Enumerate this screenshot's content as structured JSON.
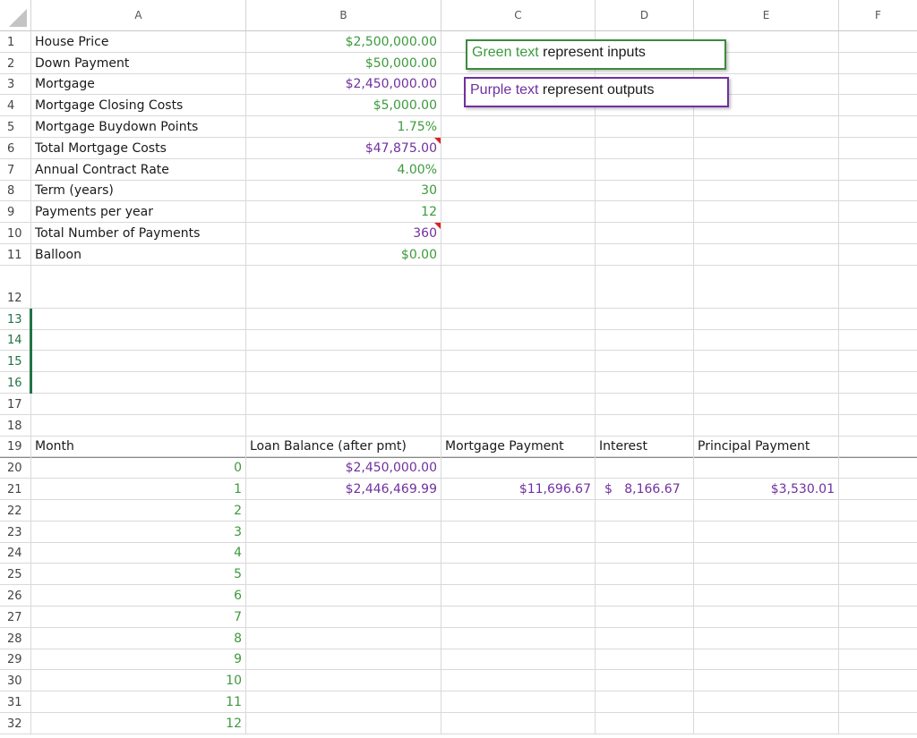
{
  "columns": [
    "A",
    "B",
    "C",
    "D",
    "E",
    "F"
  ],
  "rows": [
    {
      "n": "1",
      "a": "House Price",
      "b": "$2,500,000.00",
      "bc": "green"
    },
    {
      "n": "2",
      "a": "Down Payment",
      "b": "$50,000.00",
      "bc": "green"
    },
    {
      "n": "3",
      "a": "Mortgage",
      "b": "$2,450,000.00",
      "bc": "purple"
    },
    {
      "n": "4",
      "a": "Mortgage Closing Costs",
      "b": "$5,000.00",
      "bc": "green"
    },
    {
      "n": "5",
      "a": "Mortgage Buydown Points",
      "b": "1.75%",
      "bc": "green"
    },
    {
      "n": "6",
      "a": "Total Mortgage Costs",
      "b": "$47,875.00",
      "bc": "purple",
      "comment": true
    },
    {
      "n": "7",
      "a": "Annual Contract Rate",
      "b": "4.00%",
      "bc": "green"
    },
    {
      "n": "8",
      "a": "Term (years)",
      "b": "30",
      "bc": "green"
    },
    {
      "n": "9",
      "a": "Payments per year",
      "b": "12",
      "bc": "green"
    },
    {
      "n": "10",
      "a": "Total Number of Payments",
      "b": "360",
      "bc": "purple",
      "comment": true
    },
    {
      "n": "11",
      "a": "Balloon",
      "b": "$0.00",
      "bc": "green"
    }
  ],
  "empty_rows": [
    "12",
    "13",
    "14",
    "15",
    "16",
    "17",
    "18"
  ],
  "table_header": {
    "n": "19",
    "month": "Month",
    "balance": "Loan Balance (after pmt)",
    "payment": "Mortgage Payment",
    "interest": "Interest",
    "principal": "Principal Payment"
  },
  "table_rows": [
    {
      "n": "20",
      "month": "0",
      "balance": "$2,450,000.00",
      "payment": "",
      "interest": "",
      "principal": ""
    },
    {
      "n": "21",
      "month": "1",
      "balance": "$2,446,469.99",
      "payment": "$11,696.67",
      "interest": "$   8,166.67",
      "principal": "$3,530.01"
    },
    {
      "n": "22",
      "month": "2",
      "balance": "",
      "payment": "",
      "interest": "",
      "principal": ""
    },
    {
      "n": "23",
      "month": "3",
      "balance": "",
      "payment": "",
      "interest": "",
      "principal": ""
    },
    {
      "n": "24",
      "month": "4",
      "balance": "",
      "payment": "",
      "interest": "",
      "principal": ""
    },
    {
      "n": "25",
      "month": "5",
      "balance": "",
      "payment": "",
      "interest": "",
      "principal": ""
    },
    {
      "n": "26",
      "month": "6",
      "balance": "",
      "payment": "",
      "interest": "",
      "principal": ""
    },
    {
      "n": "27",
      "month": "7",
      "balance": "",
      "payment": "",
      "interest": "",
      "principal": ""
    },
    {
      "n": "28",
      "month": "8",
      "balance": "",
      "payment": "",
      "interest": "",
      "principal": ""
    },
    {
      "n": "29",
      "month": "9",
      "balance": "",
      "payment": "",
      "interest": "",
      "principal": ""
    },
    {
      "n": "30",
      "month": "10",
      "balance": "",
      "payment": "",
      "interest": "",
      "principal": ""
    },
    {
      "n": "31",
      "month": "11",
      "balance": "",
      "payment": "",
      "interest": "",
      "principal": ""
    },
    {
      "n": "32",
      "month": "12",
      "balance": "",
      "payment": "",
      "interest": "",
      "principal": ""
    }
  ],
  "legend": {
    "inputs_colored": "Green text",
    "inputs_rest": " represent inputs",
    "outputs_colored": "Purple text",
    "outputs_rest": " represent outputs"
  },
  "colors": {
    "input": "#3c9a3c",
    "output": "#7030a0",
    "comment_marker": "#e02020"
  }
}
